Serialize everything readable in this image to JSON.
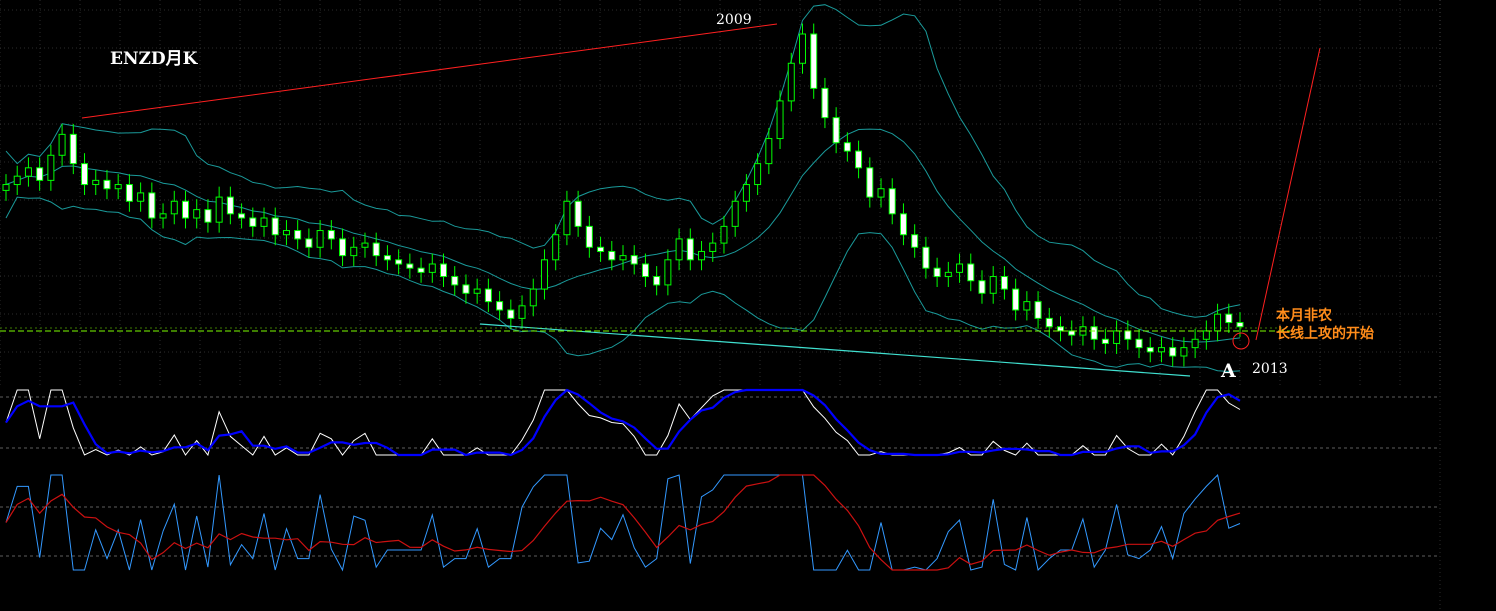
{
  "annotations": {
    "chart_title": "ENZD月K",
    "year_peak": "2009",
    "year_low": "2013",
    "point_a": "A",
    "note_line1": "本月非农",
    "note_line2": "长线上攻的开始"
  },
  "colors": {
    "background": "#000000",
    "grid": "#5a5a5a",
    "candle": "#00ff00",
    "candle_body_up": "#000000",
    "candle_body_down": "#ffffff",
    "bollinger": "#1a9a9a",
    "trendline_red": "#ff2020",
    "support_line": "#40e0d0",
    "horizontal_level": "#7cfc00",
    "stoch_k": "#ffffff",
    "stoch_d": "#0000ff",
    "osc_fast": "#3399ff",
    "osc_slow": "#cc1111",
    "note_text": "#ff8c1a",
    "label_text": "#ffffff"
  },
  "chart_data": {
    "type": "candlestick",
    "title": "ENZD月K",
    "price_series": [
      0.7,
      0.72,
      0.74,
      0.71,
      0.77,
      0.82,
      0.75,
      0.7,
      0.71,
      0.69,
      0.7,
      0.66,
      0.68,
      0.62,
      0.63,
      0.66,
      0.62,
      0.64,
      0.61,
      0.67,
      0.63,
      0.62,
      0.6,
      0.62,
      0.58,
      0.59,
      0.57,
      0.55,
      0.59,
      0.57,
      0.53,
      0.55,
      0.56,
      0.53,
      0.52,
      0.51,
      0.5,
      0.49,
      0.51,
      0.48,
      0.46,
      0.44,
      0.45,
      0.42,
      0.4,
      0.38,
      0.41,
      0.45,
      0.52,
      0.58,
      0.66,
      0.6,
      0.55,
      0.54,
      0.52,
      0.53,
      0.51,
      0.48,
      0.46,
      0.52,
      0.57,
      0.52,
      0.54,
      0.56,
      0.6,
      0.66,
      0.7,
      0.75,
      0.81,
      0.9,
      0.99,
      1.06,
      0.93,
      0.86,
      0.8,
      0.78,
      0.74,
      0.67,
      0.69,
      0.63,
      0.58,
      0.55,
      0.5,
      0.48,
      0.49,
      0.51,
      0.47,
      0.44,
      0.48,
      0.45,
      0.4,
      0.42,
      0.38,
      0.36,
      0.35,
      0.34,
      0.36,
      0.33,
      0.32,
      0.35,
      0.33,
      0.31,
      0.3,
      0.31,
      0.29,
      0.31,
      0.33,
      0.35,
      0.39,
      0.37,
      0.36
    ],
    "annotations": [
      "2009",
      "2013",
      "A",
      "本月非农",
      "长线上攻的开始"
    ]
  }
}
